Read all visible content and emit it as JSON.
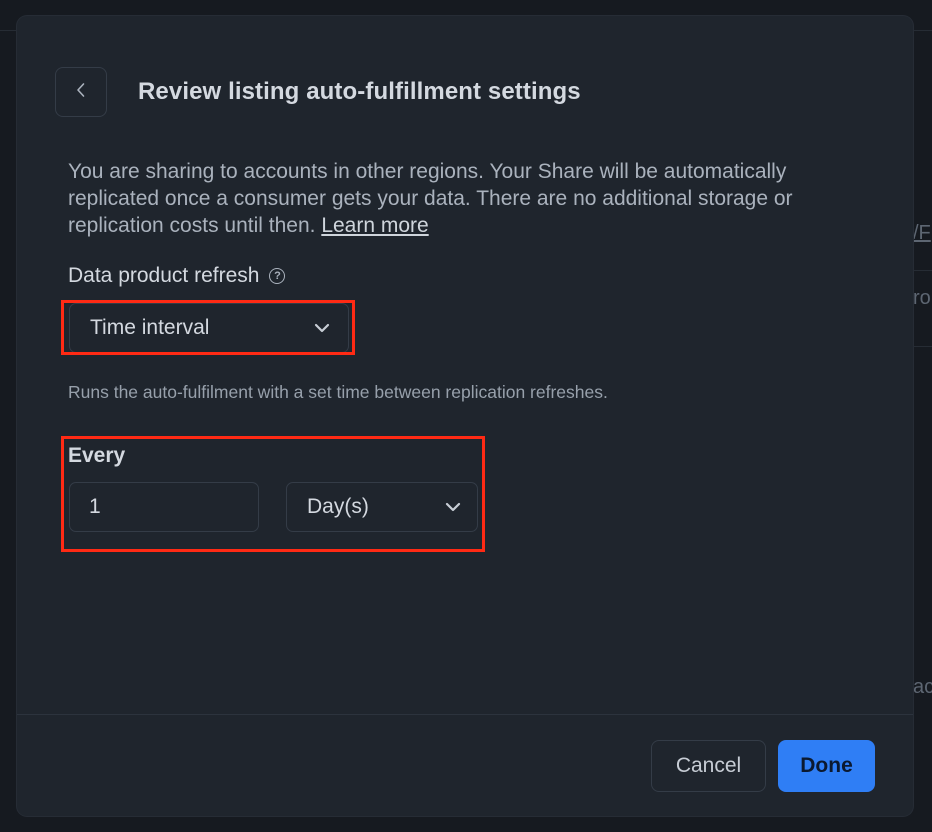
{
  "dialog": {
    "title": "Review listing auto-fulfillment settings",
    "description": "You are sharing to accounts in other regions. Your Share will be automatically replicated once a consumer gets your data. There are no additional storage or replication costs until then.",
    "learn_more_link": "Learn more",
    "refresh": {
      "label": "Data product refresh",
      "help_icon": "question-circle-icon",
      "selected": "Time interval",
      "hint": "Runs the auto-fulfilment with a set time between replication refreshes."
    },
    "interval": {
      "label": "Every",
      "value": "1",
      "unit_selected": "Day(s)"
    },
    "footer": {
      "cancel_label": "Cancel",
      "done_label": "Done"
    }
  },
  "background_fragments": {
    "right_top": "/F",
    "right_mid": "rol",
    "right_low": "ac"
  },
  "colors": {
    "modal_bg": "#1f252d",
    "primary": "#2f7ef5",
    "highlight": "#ff2a14"
  }
}
